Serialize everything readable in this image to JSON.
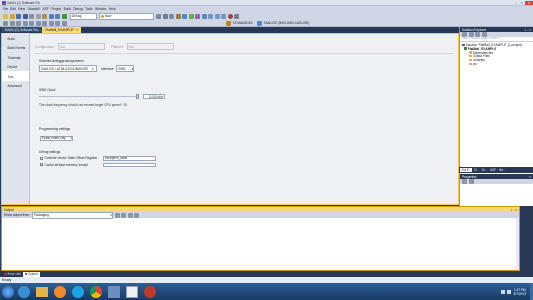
{
  "app": {
    "title": "SAM4 (C) Software Pro",
    "menu": [
      "File",
      "Edit",
      "View",
      "VAssistX",
      "ASF",
      "Project",
      "Build",
      "Debug",
      "Tools",
      "Window",
      "Help"
    ],
    "config_select": "Debug",
    "find_value": "Now",
    "device_label": "ATSAM4S16C",
    "tool_label": "SAM-ICE (0000-0000-1125-000)"
  },
  "tabs": {
    "doc_tab_1": "SAM4 (C) Software Pro",
    "doc_tab_2": "PlatBall_EXAMPLE*"
  },
  "project_props": {
    "left_nav": [
      "Build",
      "Build Events",
      "Toolchain",
      "Device",
      "Tool",
      "Advanced"
    ],
    "active_nav": "Tool",
    "configuration_label": "Configuration:",
    "configuration_value": "N/A",
    "platform_label": "Platform:",
    "platform_value": "N/A",
    "debugger_section": "Selected debugger/programmer",
    "debugger_value": "SAM-ICE • ATMLZ3201J8000057",
    "interface_label": "Interface:",
    "interface_value": "SWD",
    "swd_clock_section": "SWD Clock",
    "swd_clock_value": "2,000 kHz",
    "swd_clock_note": "The clock frequency should not exceed target CPU speed * 10.",
    "programming_section": "Programming settings",
    "programming_value": "Erase entire chip",
    "debug_section": "Debug settings",
    "override_vtor_label": "Override Vector Table Offset Register",
    "override_vtor_value": "exception_table",
    "cache_label": "Cache all flash memory except"
  },
  "solution_explorer": {
    "title": "Solution Explorer",
    "search_placeholder": "Search Solution Explorer (Ctrl+;)",
    "items": [
      {
        "label": "Solution 'PlatBall_EXAMPLE' (1 project)",
        "level": 0
      },
      {
        "label": "PlatBall_EXAMPLE",
        "level": 1
      },
      {
        "label": "Dependencies",
        "level": 2
      },
      {
        "label": "Output Files",
        "level": 2
      },
      {
        "label": "Libraries",
        "level": 2
      },
      {
        "label": "src",
        "level": 2
      }
    ],
    "bottom_tabs": [
      "Sol E..",
      "Cl..",
      "Or..",
      "ASF",
      "Ne.."
    ]
  },
  "properties": {
    "title": "Properties"
  },
  "output": {
    "title": "Output",
    "show_from_label": "Show output from:",
    "show_from_value": "Packaging"
  },
  "bottom_tabs": [
    "Error List",
    "Output"
  ],
  "status": {
    "text": "Ready"
  },
  "taskbar": {
    "clock_time": "1:37 PM",
    "clock_date": "5/7/2013"
  },
  "colors": {
    "vs_chrome": "#cfd6e5",
    "vs_dark": "#293955",
    "accent": "#eecb4a",
    "output_border": "#c79a00",
    "taskbar": "#1e4a7d"
  }
}
